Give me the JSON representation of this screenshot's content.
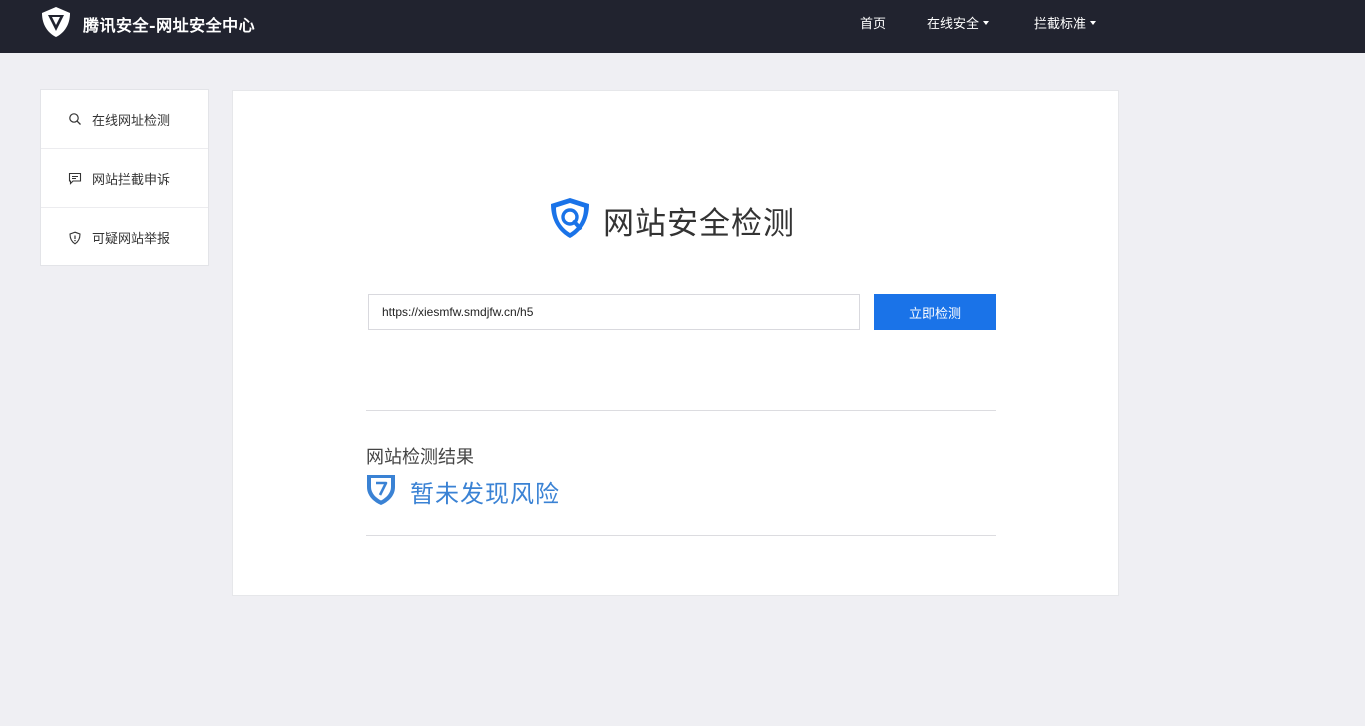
{
  "header": {
    "brand_name": "腾讯安全-网址安全中心",
    "nav": [
      {
        "label": "首页",
        "has_dropdown": false
      },
      {
        "label": "在线安全",
        "has_dropdown": true
      },
      {
        "label": "拦截标准",
        "has_dropdown": true
      }
    ]
  },
  "sidebar": {
    "items": [
      {
        "label": "在线网址检测",
        "icon": "search-icon"
      },
      {
        "label": "网站拦截申诉",
        "icon": "message-icon"
      },
      {
        "label": "可疑网站举报",
        "icon": "shield-icon"
      }
    ]
  },
  "main": {
    "title": "网站安全检测",
    "url_value": "https://xiesmfw.smdjfw.cn/h5",
    "check_button": "立即检测",
    "result_title": "网站检测结果",
    "result_text": "暂未发现风险"
  },
  "colors": {
    "header_bg": "#21232f",
    "page_bg": "#efeff3",
    "accent": "#1a73e8",
    "result": "#3a82d4"
  }
}
